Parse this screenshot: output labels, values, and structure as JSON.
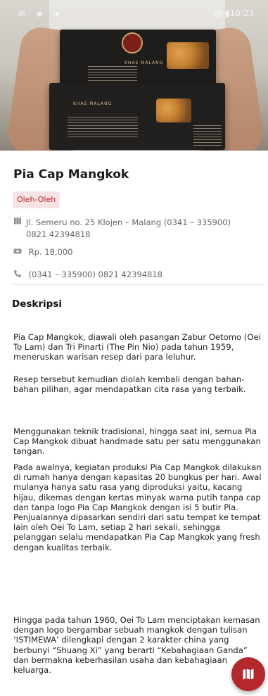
{
  "status_bar": {
    "time": "10:23"
  },
  "hero": {
    "box_label_top": "KHAS MALANG",
    "box_label_bottom": "KHAS MALANG"
  },
  "place": {
    "title": "Pia  Cap Mangkok",
    "category": "Oleh-Oleh",
    "address": "Jl. Semeru no. 25 Klojen – Malang (0341 – 335900) 0821 42394818",
    "price": "Rp. 18,000",
    "phone": "(0341 – 335900) 0821 42394818"
  },
  "description": {
    "heading": "Deskripsi",
    "paragraphs": [
      "Pia Cap Mangkok, diawali oleh pasangan Zabur Oetomo (Oei To Lam) dan Tri Pinarti (The Pin Nio) pada tahun 1959, meneruskan warisan resep dari para leluhur.",
      "Resep tersebut kemudian diolah kembali dengan bahan-bahan pilihan, agar mendapatkan cita rasa yang terbaik.",
      "Menggunakan teknik tradisional, hingga saat ini, semua Pia Cap Mangkok dibuat handmade satu per satu menggunakan tangan.",
      "Pada awalnya, kegiatan produksi Pia Cap Mangkok dilakukan di rumah hanya dengan kapasitas 20 bungkus per hari. Awal mulanya hanya satu rasa yang diproduksi yaitu, kacang hijau, dikemas dengan kertas minyak warna putih tanpa cap dan tanpa logo Pia Cap Mangkok dengan isi 5 butir Pia. Penjualannya dipasarkan sendiri dari satu tempat ke tempat lain oleh Oei To Lam, setiap 2 hari sekali, sehingga pelanggan selalu mendapatkan Pia Cap Mangkok yang fresh dengan kualitas terbaik.",
      "Hingga pada tahun 1960, Oei To Lam menciptakan kemasan dengan logo bergambar sebuah mangkok dengan tulisan ‘ISTIMEWA’ dilengkapi dengan 2 karakter china yang berbunyi “Shuang Xi” yang berarti “Kebahagiaan Ganda” dan bermakna keberhasilan usaha dan kebahagiaan keluarga."
    ]
  },
  "icons": {
    "address": "map-icon",
    "price": "cash-icon",
    "phone": "phone-icon",
    "fab": "map-icon"
  },
  "colors": {
    "accent": "#b3272d",
    "badge_bg": "#f6e3e3"
  }
}
